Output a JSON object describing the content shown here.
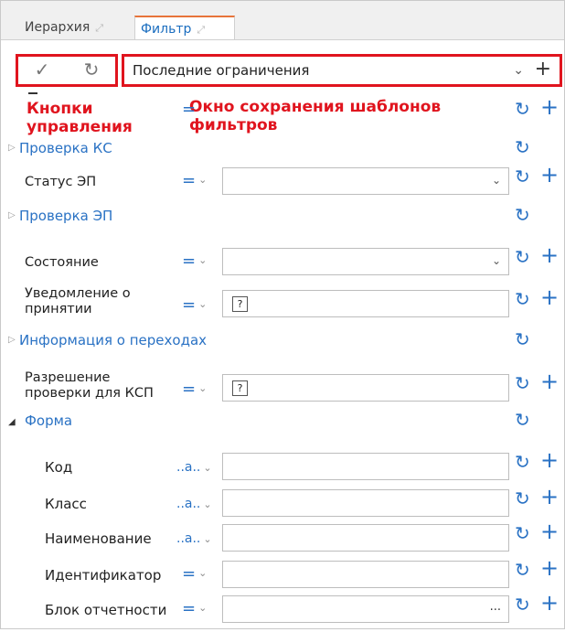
{
  "tabs": [
    {
      "label": "Иерархия",
      "pin": "⤢"
    },
    {
      "label": "Фильтр",
      "pin": "⤢"
    }
  ],
  "toolbar": {
    "apply_icon": "✓",
    "reset_icon": "↻",
    "template_value": "Последние ограничения",
    "chevron": "⌄",
    "add": "+"
  },
  "annotations": {
    "buttons": "Кнопки\nуправления",
    "templates": "Окно сохранения шаблонов\nфильтров"
  },
  "filter": {
    "op_eq": "=",
    "op_chev": "⌄",
    "op_contains": "..a..",
    "reset_icon": "↻",
    "add_icon": "+",
    "tri_closed": "▷",
    "tri_open": "◢",
    "q_mark": "?",
    "dots": "...",
    "rows": [
      {
        "kind": "group",
        "label": "Проверка КС",
        "open": false
      },
      {
        "kind": "field",
        "label": "Статус ЭП",
        "op": "eq",
        "input": "dropdown"
      },
      {
        "kind": "group",
        "label": "Проверка ЭП",
        "open": false
      },
      {
        "kind": "field",
        "label": "Состояние",
        "op": "eq",
        "input": "dropdown"
      },
      {
        "kind": "field",
        "label": "Уведомление о\nпринятии",
        "op": "eq",
        "input": "bool"
      },
      {
        "kind": "group",
        "label": "Информация о переходах",
        "open": false
      },
      {
        "kind": "field",
        "label": "Разрешение\nпроверки для КСП",
        "op": "eq",
        "input": "bool"
      },
      {
        "kind": "group",
        "label": "Форма",
        "open": true
      },
      {
        "kind": "field",
        "label": "Код",
        "op": "contains",
        "input": "text"
      },
      {
        "kind": "field",
        "label": "Класс",
        "op": "contains",
        "input": "text"
      },
      {
        "kind": "field",
        "label": "Наименование",
        "op": "contains",
        "input": "text"
      },
      {
        "kind": "field",
        "label": "Идентификатор",
        "op": "eq",
        "input": "text"
      },
      {
        "kind": "field",
        "label": "Блок отчетности",
        "op": "eq",
        "input": "lookup"
      }
    ]
  }
}
